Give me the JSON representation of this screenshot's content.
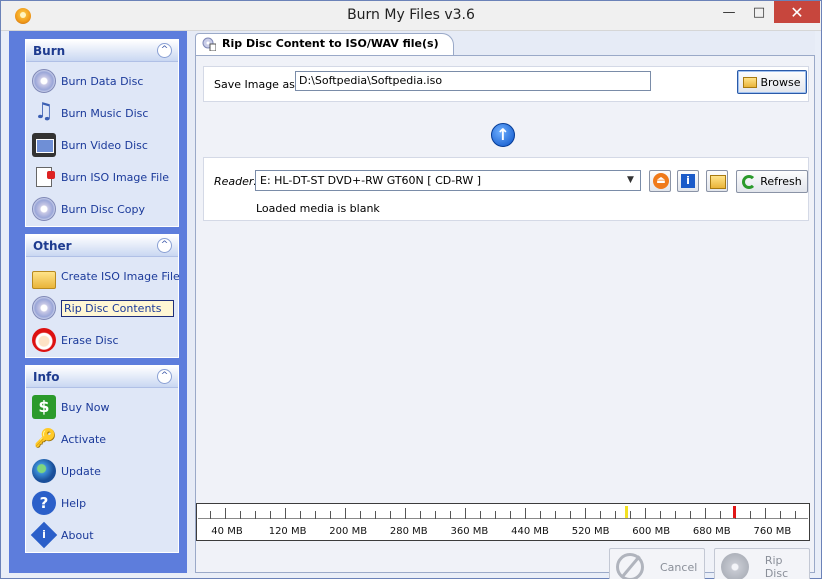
{
  "window": {
    "title": "Burn My Files v3.6"
  },
  "sidebar": {
    "groups": [
      {
        "title": "Burn",
        "items": [
          {
            "label": "Burn Data Disc",
            "icon": "disc-icon"
          },
          {
            "label": "Burn Music Disc",
            "icon": "music-note-icon"
          },
          {
            "label": "Burn Video Disc",
            "icon": "film-reel-icon"
          },
          {
            "label": "Burn ISO Image File",
            "icon": "iso-file-icon"
          },
          {
            "label": "Burn Disc Copy",
            "icon": "disc-copy-icon"
          }
        ]
      },
      {
        "title": "Other",
        "items": [
          {
            "label": "Create ISO Image File",
            "icon": "folder-disc-icon"
          },
          {
            "label": "Rip Disc Contents",
            "icon": "rip-disc-icon",
            "selected": true
          },
          {
            "label": "Erase Disc",
            "icon": "santa-icon"
          }
        ]
      },
      {
        "title": "Info",
        "items": [
          {
            "label": "Buy Now",
            "icon": "dollar-icon"
          },
          {
            "label": "Activate",
            "icon": "key-icon"
          },
          {
            "label": "Update",
            "icon": "globe-icon"
          },
          {
            "label": "Help",
            "icon": "help-icon"
          },
          {
            "label": "About",
            "icon": "about-icon"
          }
        ]
      }
    ]
  },
  "tab": {
    "label": "Rip Disc Content to ISO/WAV file(s)"
  },
  "save": {
    "label": "Save Image as:",
    "value": "D:\\Softpedia\\Softpedia.iso",
    "browse_label": "Browse"
  },
  "reader": {
    "label": "Reader:",
    "selected": "E: HL-DT-ST DVD+-RW GT60N [ CD-RW ]",
    "refresh_label": "Refresh",
    "status": "Loaded media is blank"
  },
  "ruler": {
    "labels": [
      "40 MB",
      "120 MB",
      "200 MB",
      "280 MB",
      "360 MB",
      "440 MB",
      "520 MB",
      "600 MB",
      "680 MB",
      "760 MB"
    ]
  },
  "actions": {
    "cancel_label": "Cancel",
    "rip_label": "Rip Disc"
  },
  "colors": {
    "sidebar_bg": "#5d7ddc",
    "group_title": "#1e3b8f",
    "link": "#1b3a9a",
    "close": "#c7463d"
  }
}
